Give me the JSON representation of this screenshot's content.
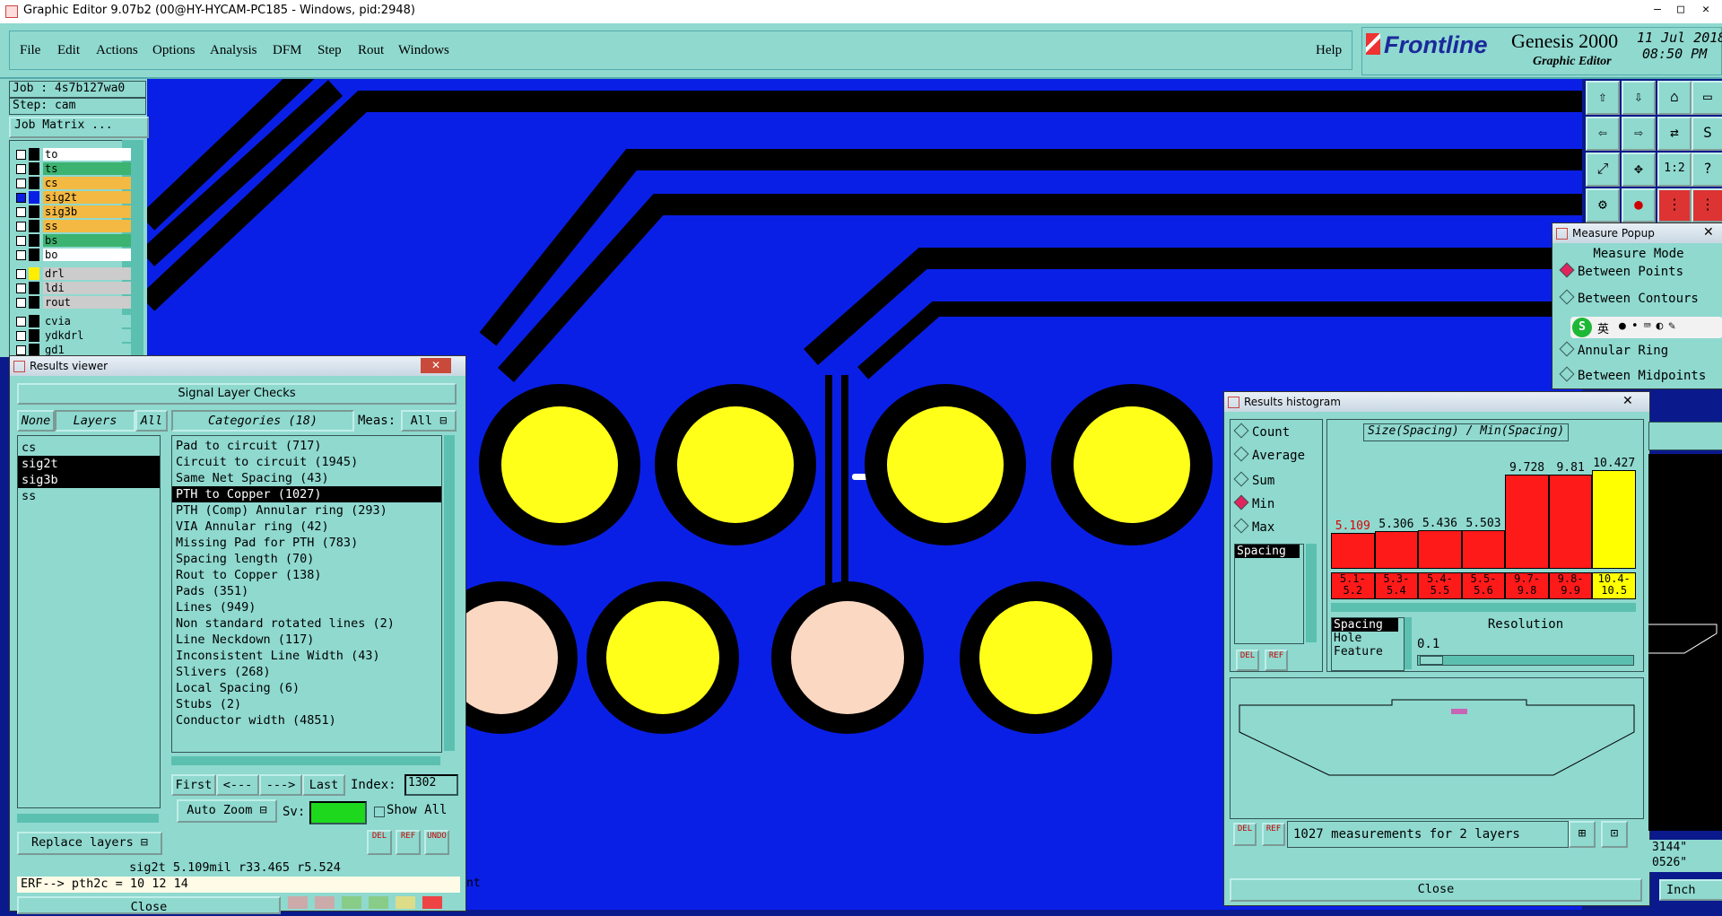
{
  "app": {
    "window_title": "Graphic Editor 9.07b2 (00@HY-HYCAM-PC185 - Windows, pid:2948)",
    "menu": [
      "File",
      "Edit",
      "Actions",
      "Options",
      "Analysis",
      "DFM",
      "Step",
      "Rout",
      "Windows"
    ],
    "help": "Help",
    "brand": "Frontline",
    "product": "Genesis 2000",
    "product_sub": "Graphic Editor",
    "date": "11 Jul 2018",
    "time": "08:50 PM"
  },
  "job": {
    "job_label": "Job : 4s7b127wa0",
    "step_label": "Step: cam",
    "job_matrix": "Job Matrix ..."
  },
  "layers": [
    {
      "name": "to",
      "color": "#ffffff"
    },
    {
      "name": "ts",
      "color": "#3cb371"
    },
    {
      "name": "cs",
      "color": "#f4b942"
    },
    {
      "name": "sig2t",
      "color": "#f4b942"
    },
    {
      "name": "sig3b",
      "color": "#f4b942"
    },
    {
      "name": "ss",
      "color": "#f4b942"
    },
    {
      "name": "bs",
      "color": "#3cb371"
    },
    {
      "name": "bo",
      "color": "#ffffff"
    },
    {
      "name": "drl",
      "color": "#cccccc"
    },
    {
      "name": "ldi",
      "color": "#cccccc"
    },
    {
      "name": "rout",
      "color": "#cccccc"
    },
    {
      "name": "cvia",
      "color": "#8fd9cf"
    },
    {
      "name": "ydkdrl",
      "color": "#8fd9cf"
    },
    {
      "name": "gd1",
      "color": "#8fd9cf"
    }
  ],
  "results_viewer": {
    "title": "Results viewer",
    "header": "Signal Layer Checks",
    "none_btn": "None",
    "layers_btn": "Layers",
    "all_btn": "All",
    "categories_btn": "Categories (18)",
    "meas_label": "Meas:",
    "meas_value": "All",
    "layers": [
      "cs",
      "sig2t",
      "sig3b",
      "ss"
    ],
    "categories": [
      "Pad to circuit (717)",
      "Circuit to circuit (1945)",
      "Same Net Spacing (43)",
      "PTH to Copper (1027)",
      "PTH (Comp) Annular ring (293)",
      "VIA Annular ring (42)",
      "Missing Pad for PTH (783)",
      "Spacing length (70)",
      "Rout to Copper (138)",
      "Pads (351)",
      "Lines (949)",
      "Non standard rotated lines (2)",
      "Line Neckdown (117)",
      "Inconsistent Line Width (43)",
      "Slivers (268)",
      "Local Spacing (6)",
      "Stubs (2)",
      "Conductor width (4851)"
    ],
    "first": "First",
    "prev": "<---",
    "next": "--->",
    "last": "Last",
    "index_label": "Index:",
    "index_value": "1302",
    "auto_zoom": "Auto Zoom",
    "sv_label": "Sv:",
    "show_all": "Show All",
    "replace_layers": "Replace layers",
    "del": "DEL",
    "ref": "REF",
    "undo": "UNDO",
    "status": "sig2t 5.109mil  r33.465  r5.524",
    "erf": "ERF--> pth2c = 10 12 14",
    "close": "Close"
  },
  "measure_popup": {
    "title": "Measure Popup",
    "mode_label": "Measure Mode",
    "options": [
      "Between Points",
      "Between Contours",
      "Annular Ring",
      "Between Midpoints"
    ]
  },
  "histogram": {
    "title": "Results histogram",
    "stats": [
      "Count",
      "Average",
      "Sum",
      "Min",
      "Max"
    ],
    "selected_stat": "Min",
    "list_item": "Spacing",
    "chart_title": "Size(Spacing) / Min(Spacing)",
    "options": [
      "Spacing",
      "Hole",
      "Feature"
    ],
    "resolution_label": "Resolution",
    "resolution_value": "0.1",
    "summary": "1027 measurements for 2 layers",
    "close": "Close"
  },
  "chart_data": {
    "type": "bar",
    "title": "Size(Spacing) / Min(Spacing)",
    "categories": [
      "5.1-5.2",
      "5.3-5.4",
      "5.4-5.5",
      "5.5-5.6",
      "9.7-9.8",
      "9.8-9.9",
      "10.4-10.5"
    ],
    "values": [
      5.109,
      5.306,
      5.436,
      5.503,
      9.728,
      9.81,
      10.427
    ],
    "value_labels": [
      "5.109",
      "5.306",
      "5.436",
      "5.503",
      "9.728",
      "9.81",
      "10.427"
    ],
    "range_top": [
      "5.1-",
      "5.3-",
      "5.4-",
      "5.5-",
      "9.7-",
      "9.8-",
      "10.4-"
    ],
    "range_bottom": [
      "5.2",
      "5.4",
      "5.5",
      "5.6",
      "9.8",
      "9.9",
      "10.5"
    ],
    "colors": [
      "#ff1a1a",
      "#ff1a1a",
      "#ff1a1a",
      "#ff1a1a",
      "#ff1a1a",
      "#ff1a1a",
      "#ffff00"
    ],
    "ylim": [
      0,
      11
    ]
  },
  "right_edge": {
    "coord1": "3144\"",
    "coord2": "0526\"",
    "units": "Inch"
  },
  "canvas_text": "nt",
  "ime": {
    "lang": "英"
  }
}
